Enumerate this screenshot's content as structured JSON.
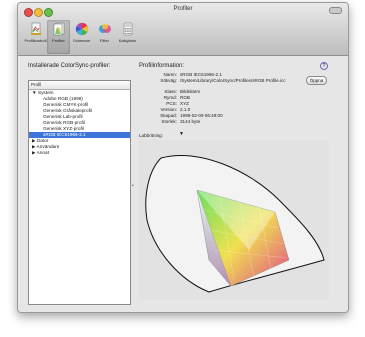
{
  "window": {
    "title": "Profiler"
  },
  "toolbar": {
    "items": [
      {
        "label": "Profilkontroll",
        "icon": "profile-check-icon"
      },
      {
        "label": "Profiler",
        "icon": "profiles-icon",
        "selected": true
      },
      {
        "label": "Scheman",
        "icon": "schemes-icon"
      },
      {
        "label": "Filter",
        "icon": "filter-icon"
      },
      {
        "label": "Kalkylator",
        "icon": "calculator-icon"
      }
    ]
  },
  "left": {
    "title": "Installerade ColorSync-profiler:",
    "column_header": "Profil",
    "system_group": "System",
    "system_items": [
      "Adobe RGB (1998)",
      "Generisk CMYK-profil",
      "Generisk Gråskaleprofil",
      "Generisk Lab-profil",
      "Generisk RGB-profil",
      "Generisk XYZ-profil",
      "sRGB IEC61966-2.1"
    ],
    "selected_item": "sRGB IEC61966-2.1",
    "other_groups": [
      "Dator",
      "Användare",
      "Annat"
    ],
    "split_handle": "•"
  },
  "right": {
    "title": "Profilinformation:",
    "fields": {
      "name_label": "Namn:",
      "name": "sRGB IEC61966-2.1",
      "path_label": "Sökväg:",
      "path": "/System/Library/ColorSync/Profiles/sRGB Profile.icc",
      "class_label": "Klass:",
      "class": "Bildskärm",
      "space_label": "Rymd:",
      "space": "RGB",
      "pcs_label": "PCS:",
      "pcs": "XYZ",
      "version_label": "Version:",
      "version": "2.1.0",
      "created_label": "Skapad:",
      "created": "1998-02-09 06:49:00",
      "size_label": "Storlek:",
      "size": "3144 byte"
    },
    "open_button": "Öppna",
    "lab_label": "Labbritning:",
    "lab_arrow": "▼"
  },
  "colors": {
    "selection": "#3c74d8",
    "info_icon": "#5b44a5"
  }
}
